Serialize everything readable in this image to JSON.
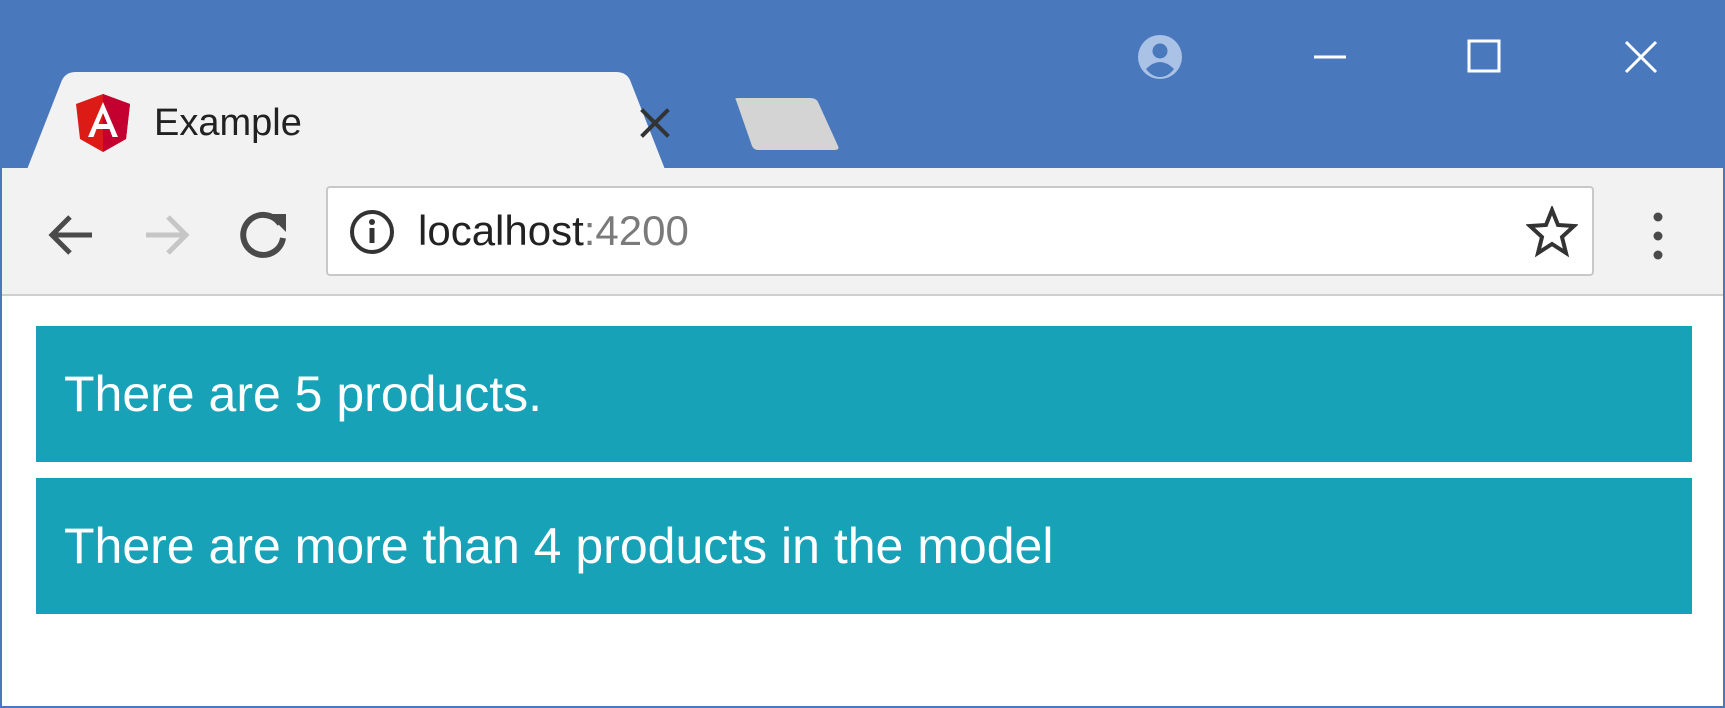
{
  "browser": {
    "tab": {
      "title": "Example",
      "favicon": "angular-logo-icon"
    },
    "address_bar": {
      "host": "localhost",
      "port": ":4200"
    },
    "colors": {
      "frame": "#4a78bc",
      "toolbar": "#f2f2f2",
      "tab": "#f2f2f2"
    }
  },
  "content": {
    "alerts": [
      {
        "text": "There are 5 products."
      },
      {
        "text": "There are more than 4 products in the model"
      }
    ],
    "colors": {
      "alert_bg": "#17a2b8",
      "alert_text": "#ffffff"
    }
  }
}
